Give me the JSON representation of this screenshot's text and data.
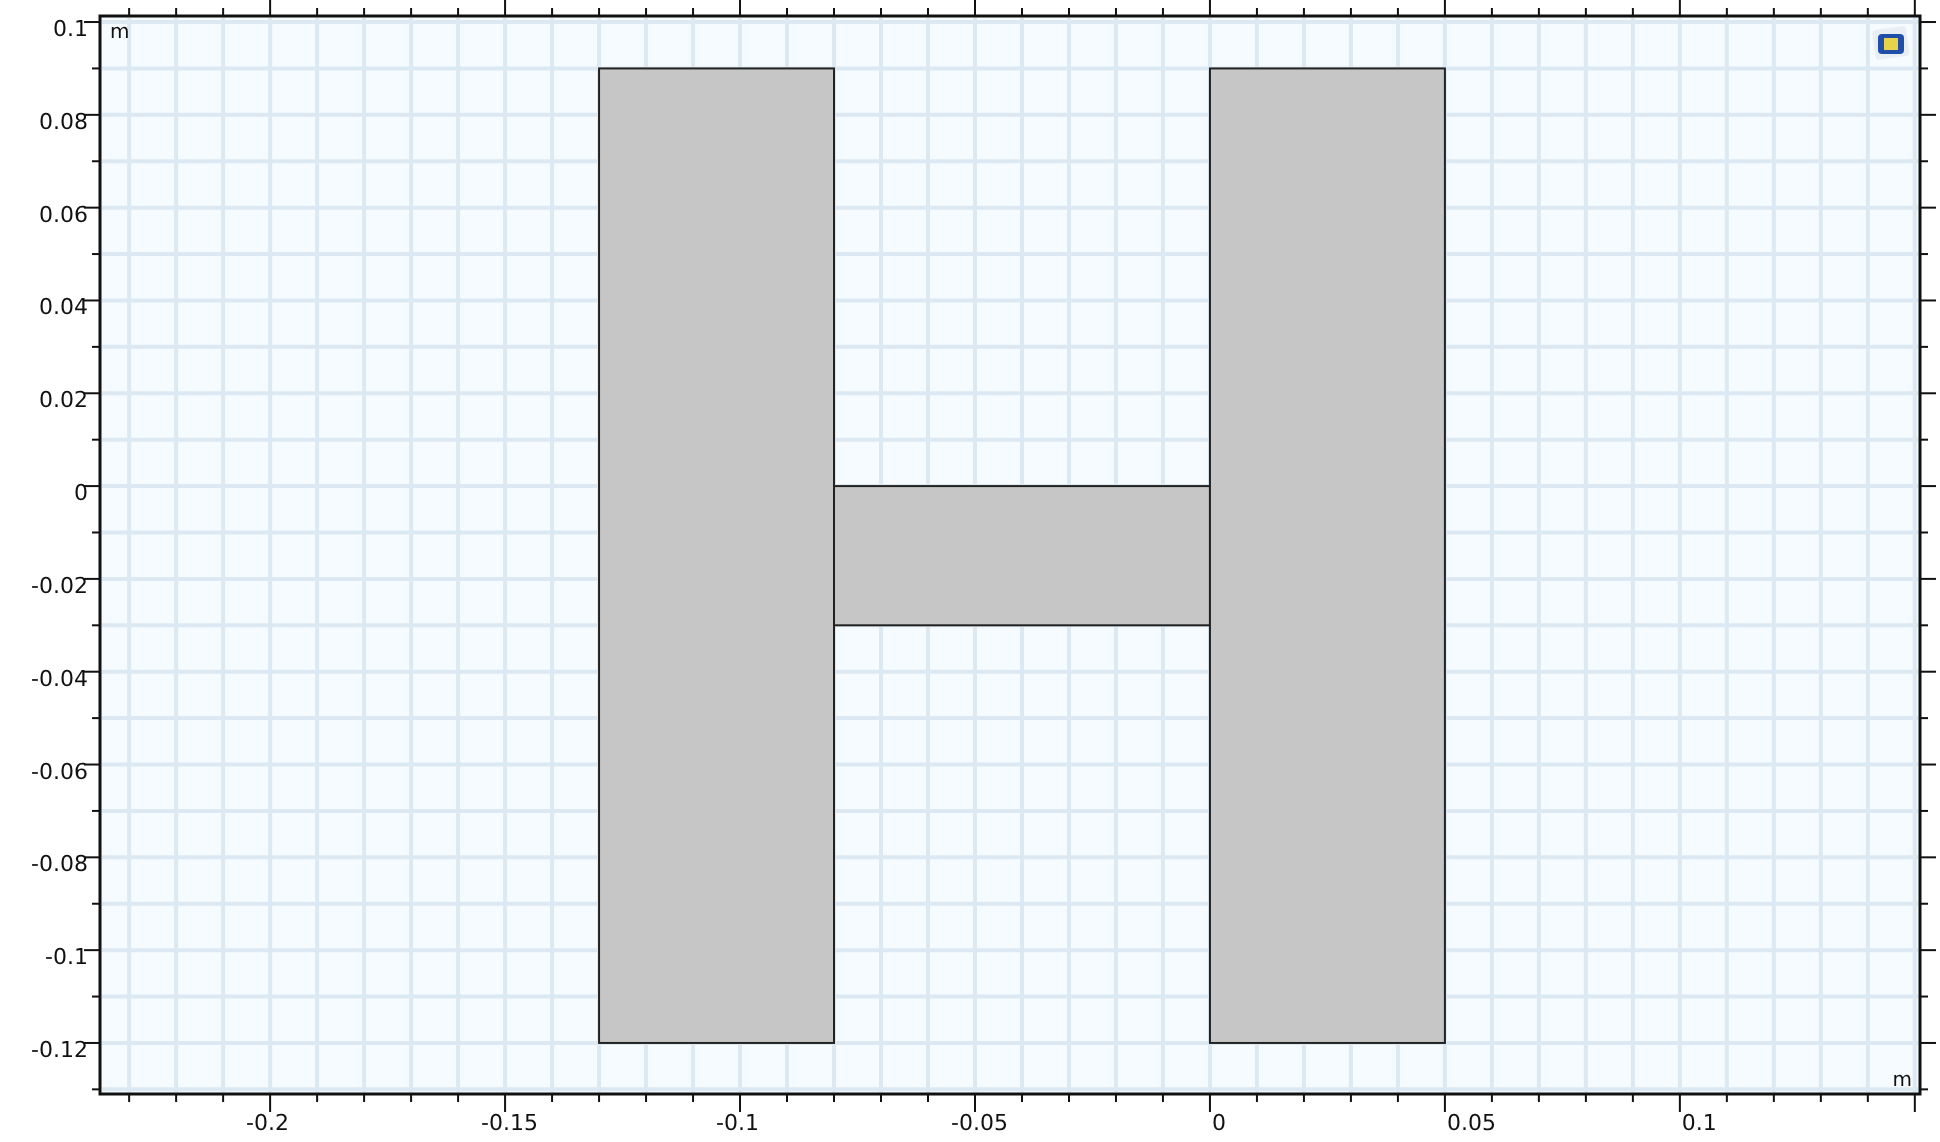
{
  "plot": {
    "x_unit": "m",
    "y_unit": "m",
    "xticks": [
      "-0.2",
      "-0.15",
      "-0.1",
      "-0.05",
      "0",
      "0.05",
      "0.1"
    ],
    "yticks": [
      "0.1",
      "0.08",
      "0.06",
      "0.04",
      "0.02",
      "0",
      "-0.02",
      "-0.04",
      "-0.06",
      "-0.08",
      "-0.1",
      "-0.12"
    ]
  }
}
